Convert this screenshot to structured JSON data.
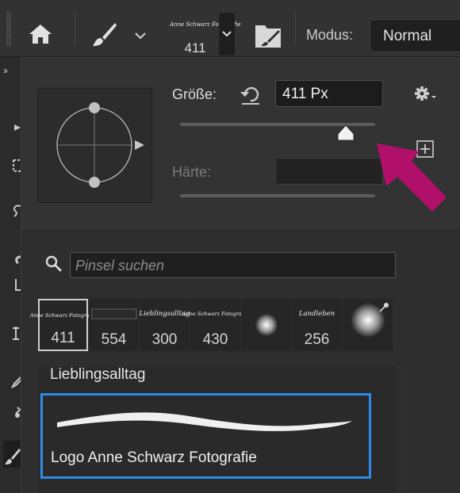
{
  "toolbar": {
    "brush_preset_signature": "Anne Schwarz Fotografie",
    "brush_preset_size": "411",
    "mode_label": "Modus:",
    "mode_value": "Normal"
  },
  "brush_panel": {
    "size_label": "Größe:",
    "size_value": "411 Px",
    "size_slider_fraction": 0.84,
    "hardness_label": "Härte:",
    "hardness_value": "",
    "search_placeholder": "Pinsel suchen",
    "presets": [
      {
        "preview": "Anne Schwarz Fotografie",
        "size": "411",
        "selected": true
      },
      {
        "preview": "",
        "size": "554",
        "selected": false
      },
      {
        "preview": "Lieblingsalltag",
        "size": "300",
        "selected": false
      },
      {
        "preview": "Anne Schwarz Fotografie",
        "size": "430",
        "selected": false
      },
      {
        "preview": "",
        "size": "",
        "selected": false
      },
      {
        "preview": "Landleben",
        "size": "256",
        "selected": false
      },
      {
        "preview": "",
        "size": "",
        "selected": false
      }
    ],
    "list": [
      {
        "label": "Lieblingsalltag"
      },
      {
        "label": "Logo Anne Schwarz Fotografie",
        "selected": true
      }
    ]
  },
  "colors": {
    "selection_blue": "#2d8ceb",
    "annotation_arrow": "#b0106a"
  }
}
